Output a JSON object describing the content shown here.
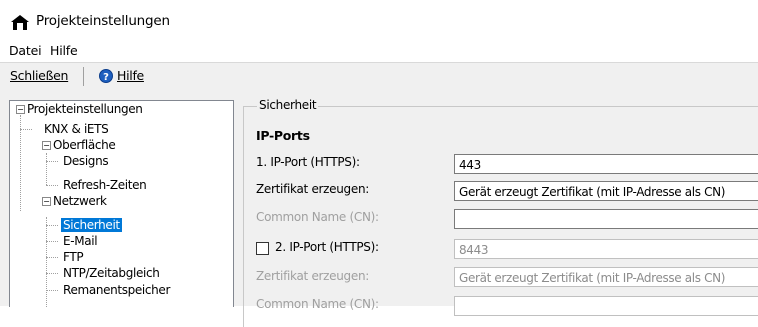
{
  "window": {
    "title": "Projekteinstellungen"
  },
  "menu": {
    "items": [
      "Datei",
      "Hilfe"
    ]
  },
  "toolbar": {
    "close_label": "Schließen",
    "help_label": "Hilfe"
  },
  "tree": {
    "root": "Projekteinstellungen",
    "knx": "KNX & iETS",
    "oberflaeche": "Oberfläche",
    "designs": "Designs",
    "refresh": "Refresh-Zeiten",
    "netzwerk": "Netzwerk",
    "sicherheit": "Sicherheit",
    "email": "E-Mail",
    "ftp": "FTP",
    "ntp": "NTP/Zeitabgleich",
    "remanent": "Remanentspeicher"
  },
  "panel": {
    "group_title": "Sicherheit",
    "section_title": "IP-Ports",
    "port1_label": "1. IP-Port (HTTPS):",
    "port1_value": "443",
    "cert1_label": "Zertifikat erzeugen:",
    "cert1_value": "Gerät erzeugt Zertifikat (mit IP-Adresse als CN)",
    "cn1_label": "Common Name (CN):",
    "cn1_value": "",
    "port2_label": "2. IP-Port (HTTPS):",
    "port2_value": "8443",
    "port2_checked": false,
    "cert2_label": "Zertifikat erzeugen:",
    "cert2_value": "Gerät erzeugt Zertifikat (mit IP-Adresse als CN)",
    "cn2_label": "Common Name (CN):",
    "cn2_value": ""
  },
  "colors": {
    "selection": "#0078d7",
    "disabled_text": "#a0a0a0",
    "toolbar_bg": "#f0f0f0"
  }
}
